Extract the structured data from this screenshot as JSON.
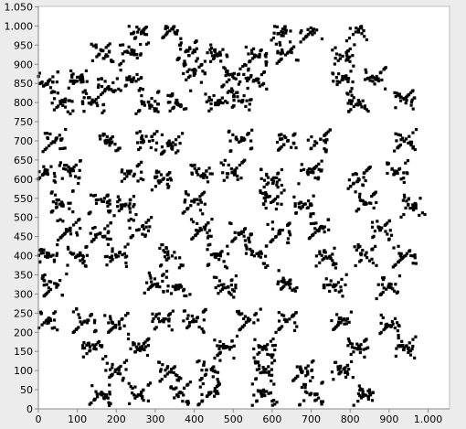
{
  "chart_data": {
    "type": "scatter",
    "title": "",
    "xlabel": "",
    "ylabel": "",
    "xlim": [
      0,
      1050
    ],
    "ylim": [
      0,
      1050
    ],
    "x_ticks": [
      0,
      100,
      200,
      300,
      400,
      500,
      600,
      700,
      800,
      900,
      1000
    ],
    "x_tick_labels": [
      "0",
      "100",
      "200",
      "300",
      "400",
      "500",
      "600",
      "700",
      "800",
      "900",
      "1.000"
    ],
    "y_ticks": [
      0,
      50,
      100,
      150,
      200,
      250,
      300,
      350,
      400,
      450,
      500,
      550,
      600,
      650,
      700,
      750,
      800,
      850,
      900,
      950,
      1000,
      1050
    ],
    "y_tick_labels": [
      "0",
      "50",
      "100",
      "150",
      "200",
      "250",
      "300",
      "350",
      "400",
      "450",
      "500",
      "550",
      "600",
      "650",
      "700",
      "750",
      "800",
      "850",
      "900",
      "950",
      "1.000",
      "1.050"
    ],
    "grid": false,
    "legend": "none",
    "series": [
      {
        "marker": "square",
        "color": "#000000",
        "note_pattern": "Dense black point cloud forming a fractal lattice of X/plus-shaped clusters across the 0-1000 square.",
        "cluster_centers": [
          [
            260,
            980
          ],
          [
            340,
            990
          ],
          [
            620,
            985
          ],
          [
            700,
            985
          ],
          [
            820,
            990
          ],
          [
            160,
            930
          ],
          [
            240,
            930
          ],
          [
            380,
            935
          ],
          [
            460,
            925
          ],
          [
            560,
            925
          ],
          [
            640,
            930
          ],
          [
            780,
            920
          ],
          [
            20,
            850
          ],
          [
            100,
            860
          ],
          [
            180,
            840
          ],
          [
            240,
            860
          ],
          [
            400,
            880
          ],
          [
            500,
            870
          ],
          [
            560,
            860
          ],
          [
            780,
            860
          ],
          [
            860,
            860
          ],
          [
            60,
            800
          ],
          [
            140,
            800
          ],
          [
            280,
            800
          ],
          [
            360,
            800
          ],
          [
            460,
            800
          ],
          [
            520,
            810
          ],
          [
            820,
            800
          ],
          [
            940,
            810
          ],
          [
            40,
            700
          ],
          [
            180,
            700
          ],
          [
            280,
            700
          ],
          [
            340,
            690
          ],
          [
            520,
            700
          ],
          [
            640,
            700
          ],
          [
            720,
            700
          ],
          [
            940,
            700
          ],
          [
            20,
            620
          ],
          [
            80,
            620
          ],
          [
            240,
            620
          ],
          [
            320,
            600
          ],
          [
            420,
            610
          ],
          [
            500,
            620
          ],
          [
            600,
            600
          ],
          [
            700,
            620
          ],
          [
            820,
            600
          ],
          [
            920,
            620
          ],
          [
            60,
            540
          ],
          [
            160,
            540
          ],
          [
            220,
            530
          ],
          [
            400,
            540
          ],
          [
            600,
            540
          ],
          [
            680,
            530
          ],
          [
            840,
            540
          ],
          [
            960,
            530
          ],
          [
            80,
            470
          ],
          [
            160,
            460
          ],
          [
            260,
            470
          ],
          [
            420,
            470
          ],
          [
            520,
            460
          ],
          [
            620,
            460
          ],
          [
            720,
            470
          ],
          [
            880,
            470
          ],
          [
            20,
            400
          ],
          [
            100,
            400
          ],
          [
            200,
            400
          ],
          [
            340,
            400
          ],
          [
            460,
            400
          ],
          [
            560,
            400
          ],
          [
            740,
            400
          ],
          [
            840,
            400
          ],
          [
            940,
            400
          ],
          [
            40,
            320
          ],
          [
            300,
            330
          ],
          [
            360,
            320
          ],
          [
            480,
            320
          ],
          [
            640,
            330
          ],
          [
            760,
            320
          ],
          [
            900,
            320
          ],
          [
            20,
            230
          ],
          [
            120,
            230
          ],
          [
            200,
            220
          ],
          [
            320,
            230
          ],
          [
            400,
            230
          ],
          [
            540,
            230
          ],
          [
            640,
            230
          ],
          [
            780,
            230
          ],
          [
            900,
            220
          ],
          [
            140,
            160
          ],
          [
            260,
            160
          ],
          [
            480,
            160
          ],
          [
            580,
            160
          ],
          [
            820,
            160
          ],
          [
            940,
            160
          ],
          [
            200,
            100
          ],
          [
            340,
            100
          ],
          [
            440,
            100
          ],
          [
            580,
            100
          ],
          [
            680,
            100
          ],
          [
            780,
            100
          ],
          [
            160,
            40
          ],
          [
            260,
            40
          ],
          [
            360,
            40
          ],
          [
            440,
            40
          ],
          [
            580,
            40
          ],
          [
            700,
            40
          ],
          [
            840,
            40
          ]
        ]
      }
    ]
  }
}
